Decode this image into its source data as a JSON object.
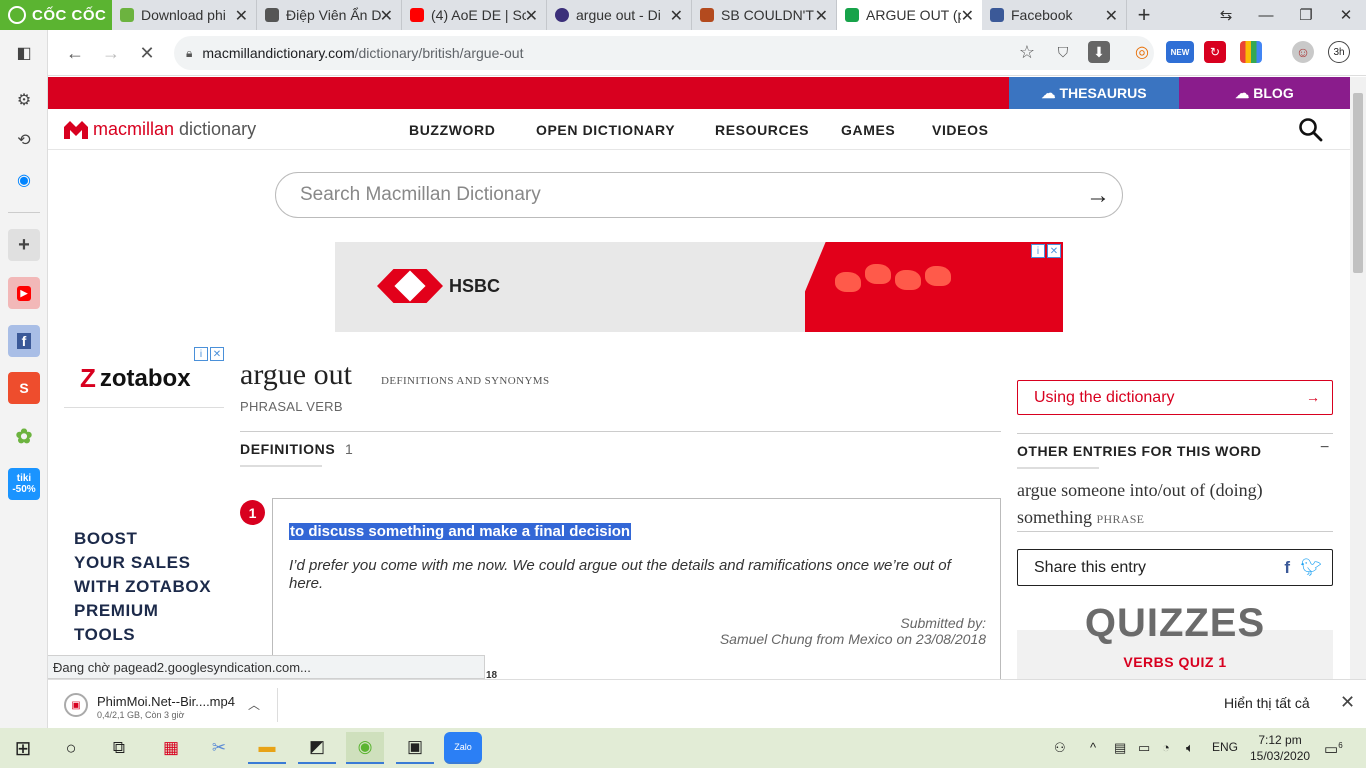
{
  "browser": {
    "brand": "CỐC CỐC",
    "tabs": [
      {
        "title": "Download phi",
        "color": "#6cb33f"
      },
      {
        "title": "Điệp Viên Ẩn D",
        "color": "#555555"
      },
      {
        "title": "(4) AoE DE | Sc",
        "color": "#ff0000"
      },
      {
        "title": "argue out - Di",
        "color": "#3b2f7a"
      },
      {
        "title": "SB COULDN'T",
        "color": "#b34a1e"
      },
      {
        "title": "ARGUE OUT (p",
        "color": "#17a34a"
      },
      {
        "title": "Facebook",
        "color": "#3b5998"
      }
    ],
    "url_host": "macmillandictionary.com",
    "url_path": "/dictionary/british/argue-out",
    "ext_new_badge": "NEW",
    "profile_badge": "3h",
    "status_text": "Đang chờ pagead2.googlesyndication.com..."
  },
  "site": {
    "top_links": {
      "thesaurus": "THESAURUS",
      "blog": "BLOG"
    },
    "logo_main": "macmillan",
    "logo_sub": "dictionary",
    "nav": [
      "BUZZWORD",
      "OPEN DICTIONARY",
      "RESOURCES",
      "GAMES",
      "VIDEOS"
    ],
    "search_placeholder": "Search Macmillan Dictionary"
  },
  "ads": {
    "top_brand": "HSBC",
    "left_brand": "zotabox",
    "left_text": [
      "BOOST",
      "YOUR SALES",
      "WITH ZOTABOX",
      "PREMIUM",
      "TOOLS"
    ]
  },
  "entry": {
    "headword": "argue out",
    "subtitle": "DEFINITIONS AND SYNONYMS",
    "pos": "PHRASAL VERB",
    "definitions_tab": "DEFINITIONS",
    "definitions_count": "1",
    "sense_number": "1",
    "definition": "to discuss something and make a final decision",
    "example": "I’d prefer you come with me now. We could argue out the details and ramifications once we’re out of here.",
    "submitted_label": "Submitted by:",
    "submitted_by": "Samuel Chung from Mexico on 23/08/2018",
    "partial_text": "18"
  },
  "sidebar_right": {
    "using_dictionary": "Using the dictionary",
    "other_entries_title": "OTHER ENTRIES FOR THIS WORD",
    "other_entry_text": "argue someone into/out of (doing) something",
    "other_entry_tag": "PHRASE",
    "share_label": "Share this entry",
    "quizzes_title": "QUIZZES",
    "quiz_name": "VERBS QUIZ 1"
  },
  "download": {
    "file_name": "PhimMoi.Net--Bir....mp4",
    "progress": "0,4/2,1 GB, Còn 3 giờ",
    "show_all": "Hiển thị tất cả"
  },
  "taskbar": {
    "language": "ENG",
    "time": "7:12 pm",
    "date": "15/03/2020",
    "notifications": "6"
  }
}
